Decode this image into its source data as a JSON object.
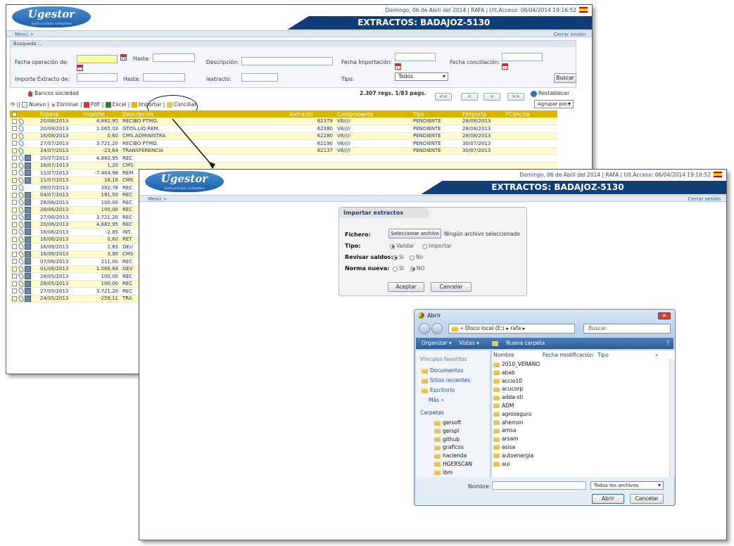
{
  "app": {
    "logo": "Ugestor",
    "logo_tagline": "Aplicaciones contables",
    "top_info": "Domingo, 06 de Abril del 2014  |  RAFA  |  Ult.Acceso: 06/04/2014 19:16:52",
    "title": "EXTRACTOS: BADAJOZ-5130",
    "menu": "Menú >",
    "logout": "Cerrar sesión"
  },
  "search": {
    "caption": "Busqueda ...",
    "fecha_operacion_label": "Fecha operación de:",
    "hasta_label": "Hasta:",
    "descripcion_label": "Descripción:",
    "fecha_importacion_label": "Fecha Importación:",
    "fecha_conciliacion_label": "Fecha conciliación:",
    "importe_label": "Importe Extracto de:",
    "hasta2_label": "Hasta:",
    "iextracto_label": "Iextracto:",
    "tipo_label": "Tipo:",
    "tipo_value": "Todos",
    "buscar": "Buscar"
  },
  "toolbar": {
    "bancos": "Bancos sociedad",
    "nuevo": "Nuevo",
    "eliminar": "Eliminar",
    "pdf": "PdF",
    "excel": "Excel",
    "importar": "Importar",
    "conciliar": "Conciliar",
    "regs": "2.307 regs. 1/83 pags.",
    "first": "<<",
    "prev": "<",
    "next": ">",
    "last": ">>",
    "restablecer": "Restablecer",
    "agrupar": "Agrupar por..."
  },
  "table": {
    "columns": [
      "Fopera",
      "Importe",
      "Descripcion",
      "Iextracto",
      "Comprobante",
      "Tipo",
      "FImporta",
      "FConcilia"
    ],
    "rows": [
      {
        "fecha": "20/08/2013",
        "importe": "4.882,95",
        "desc": "RECIBO PTMO.",
        "iextracto": "62379",
        "comp": "V8////",
        "tipo": "PENDIENTE",
        "fimporta": "28/08/2013"
      },
      {
        "fecha": "20/08/2013",
        "importe": "1.065,03",
        "desc": "GTOS.LIQ.REM.",
        "iextracto": "62380",
        "comp": "V8////",
        "tipo": "PENDIENTE",
        "fimporta": "28/08/2013"
      },
      {
        "fecha": "16/08/2013",
        "importe": "0,60",
        "desc": "CMS.ADMINISTRA",
        "iextracto": "62280",
        "comp": "V8////",
        "tipo": "PENDIENTE",
        "fimporta": "28/08/2013"
      },
      {
        "fecha": "27/07/2013",
        "importe": "3.721,20",
        "desc": "RECIBO PTMO.",
        "iextracto": "62190",
        "comp": "V8////",
        "tipo": "PENDIENTE",
        "fimporta": "30/07/2013"
      },
      {
        "fecha": "24/07/2013",
        "importe": "-23,64",
        "desc": "TRANSFERENCIA",
        "iextracto": "62137",
        "comp": "V8////",
        "tipo": "PENDIENTE",
        "fimporta": "30/07/2013"
      },
      {
        "fecha": "20/07/2013",
        "importe": "4.882,95",
        "desc": "REC",
        "iextracto": "",
        "comp": "",
        "tipo": "",
        "fimporta": ""
      },
      {
        "fecha": "16/07/2013",
        "importe": "1,20",
        "desc": "CMS",
        "iextracto": "",
        "comp": "",
        "tipo": "",
        "fimporta": ""
      },
      {
        "fecha": "11/07/2013",
        "importe": "-7.464,98",
        "desc": "REM",
        "iextracto": "",
        "comp": "",
        "tipo": "",
        "fimporta": ""
      },
      {
        "fecha": "11/07/2013",
        "importe": "16,16",
        "desc": "CMS",
        "iextracto": "",
        "comp": "",
        "tipo": "",
        "fimporta": ""
      },
      {
        "fecha": "09/07/2013",
        "importe": "392,78",
        "desc": "REC",
        "iextracto": "",
        "comp": "",
        "tipo": "",
        "fimporta": ""
      },
      {
        "fecha": "04/07/2013",
        "importe": "181,50",
        "desc": "REC",
        "iextracto": "",
        "comp": "",
        "tipo": "",
        "fimporta": ""
      },
      {
        "fecha": "28/06/2013",
        "importe": "100,00",
        "desc": "REC",
        "iextracto": "",
        "comp": "",
        "tipo": "",
        "fimporta": ""
      },
      {
        "fecha": "28/06/2013",
        "importe": "100,00",
        "desc": "REC",
        "iextracto": "",
        "comp": "",
        "tipo": "",
        "fimporta": ""
      },
      {
        "fecha": "27/06/2013",
        "importe": "3.721,20",
        "desc": "REC",
        "iextracto": "",
        "comp": "",
        "tipo": "",
        "fimporta": ""
      },
      {
        "fecha": "20/06/2013",
        "importe": "4.882,95",
        "desc": "REC",
        "iextracto": "",
        "comp": "",
        "tipo": "",
        "fimporta": ""
      },
      {
        "fecha": "16/06/2013",
        "importe": "-2,85",
        "desc": "INT.",
        "iextracto": "",
        "comp": "",
        "tipo": "",
        "fimporta": ""
      },
      {
        "fecha": "16/06/2013",
        "importe": "0,60",
        "desc": "RET",
        "iextracto": "",
        "comp": "",
        "tipo": "",
        "fimporta": ""
      },
      {
        "fecha": "16/06/2013",
        "importe": "2,83",
        "desc": "DEU",
        "iextracto": "",
        "comp": "",
        "tipo": "",
        "fimporta": ""
      },
      {
        "fecha": "16/06/2013",
        "importe": "3,90",
        "desc": "CMS",
        "iextracto": "",
        "comp": "",
        "tipo": "",
        "fimporta": ""
      },
      {
        "fecha": "07/06/2013",
        "importe": "211,00",
        "desc": "REC",
        "iextracto": "",
        "comp": "",
        "tipo": "",
        "fimporta": ""
      },
      {
        "fecha": "01/06/2013",
        "importe": "1.068,84",
        "desc": "DEV",
        "iextracto": "",
        "comp": "",
        "tipo": "",
        "fimporta": ""
      },
      {
        "fecha": "28/05/2013",
        "importe": "100,00",
        "desc": "REC",
        "iextracto": "",
        "comp": "",
        "tipo": "",
        "fimporta": ""
      },
      {
        "fecha": "28/05/2013",
        "importe": "100,00",
        "desc": "REC",
        "iextracto": "",
        "comp": "",
        "tipo": "",
        "fimporta": ""
      },
      {
        "fecha": "27/05/2013",
        "importe": "3.721,20",
        "desc": "REC",
        "iextracto": "",
        "comp": "",
        "tipo": "",
        "fimporta": ""
      },
      {
        "fecha": "24/05/2013",
        "importe": "-259,11",
        "desc": "TRA",
        "iextracto": "",
        "comp": "",
        "tipo": "",
        "fimporta": ""
      }
    ]
  },
  "importar": {
    "title": "Importar extractos",
    "fichero_label": "Fichero:",
    "select_button": "Seleccionar archivo",
    "no_file": "Ningún archivo seleccionado",
    "tipo_label": "Tipo:",
    "validar": "Validar",
    "importar": "Importar",
    "revisar_label": "Revisar saldos:",
    "si": "Si",
    "no": "No",
    "norma_label": "Norma nueva:",
    "si2": "SI",
    "no2": "NO",
    "aceptar": "Aceptar",
    "cancelar": "Cancelar"
  },
  "file_dialog": {
    "title": "Abrir",
    "path": "« Disco local (E:) ▸ rafa ▸",
    "search_placeholder": "Buscar",
    "organizar": "Organizar ▾",
    "vistas": "Vistas ▾",
    "nueva_carpeta": "Nueva carpeta",
    "favoritos_header": "Vínculos favoritos",
    "favoritos": [
      "Documentos",
      "Sitios recientes",
      "Escritorio"
    ],
    "mas": "Más »",
    "carpetas_header": "Carpetas",
    "tree": [
      "gersoft",
      "gerspl",
      "github",
      "graficos",
      "hacienda",
      "HGERSCAN",
      "ibm"
    ],
    "col_nombre": "Nombre",
    "col_fecha": "Fecha modificación",
    "col_tipo": "Tipo",
    "col_more": "»",
    "files": [
      "2010_VERANO",
      "abab",
      "accio10",
      "acucorp",
      "adda-sti",
      "ADM",
      "agroseguro",
      "ahemon",
      "amsa",
      "arsam",
      "asisa",
      "autoenergia",
      "aui"
    ],
    "nombre_label": "Nombre:",
    "filter": "Todos los archivos",
    "abrir": "Abrir",
    "cancelar": "Cancelar"
  },
  "colors": {
    "header_band": "#0f3e78",
    "table_header": "#d7b500",
    "row_highlight": "#fbfbcc"
  }
}
